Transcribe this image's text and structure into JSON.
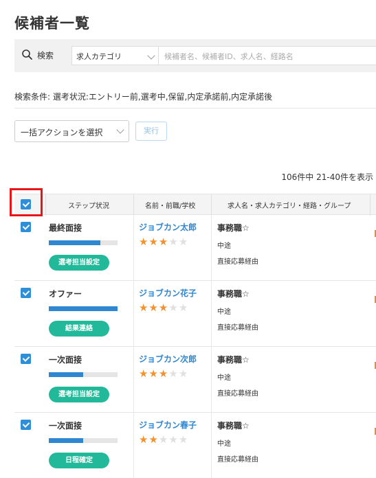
{
  "page": {
    "title": "候補者一覧"
  },
  "search": {
    "label": "検索",
    "category": "求人カテゴリ",
    "placeholder": "候補者名、候補者ID、求人名、経路名"
  },
  "conditions": "検索条件:  選考状況:エントリー前,選考中,保留,内定承諾前,内定承諾後",
  "bulk": {
    "select_label": "一括アクションを選択",
    "execute_label": "実行"
  },
  "count_text": "106件中 21-40件を表示",
  "table": {
    "headers": {
      "step": "ステップ状況",
      "name": "名前・前職/学校",
      "job": "求人名・求人カテゴリ・経路・グループ"
    },
    "rows": [
      {
        "step": "最終面接",
        "progress": 0.75,
        "action": "選考担当設定",
        "name": "ジョブカン太郎",
        "rating": 3,
        "job_title": "事務職☆",
        "job_category": "中途",
        "route": "直接応募経由",
        "checked": true
      },
      {
        "step": "オファー",
        "progress": 1.0,
        "action": "結果連絡",
        "name": "ジョブカン花子",
        "rating": 3,
        "job_title": "事務職☆",
        "job_category": "中途",
        "route": "直接応募経由",
        "checked": true
      },
      {
        "step": "一次面接",
        "progress": 0.5,
        "action": "選考担当設定",
        "name": "ジョブカン次郎",
        "rating": 3,
        "job_title": "事務職☆",
        "job_category": "中途",
        "route": "直接応募経由",
        "checked": true
      },
      {
        "step": "一次面接",
        "progress": 0.5,
        "action": "日程確定",
        "name": "ジョブカン春子",
        "rating": 2,
        "job_title": "事務職☆",
        "job_category": "中途",
        "route": "直接応募経由",
        "checked": true
      }
    ]
  },
  "icons": {
    "search": "search-icon",
    "chevron": "chevron-down-icon",
    "check": "check-icon",
    "star": "star-icon"
  },
  "colors": {
    "accent": "#2f86d1",
    "button": "#22b89a",
    "star": "#f2922e",
    "highlight": "#e8141a"
  }
}
